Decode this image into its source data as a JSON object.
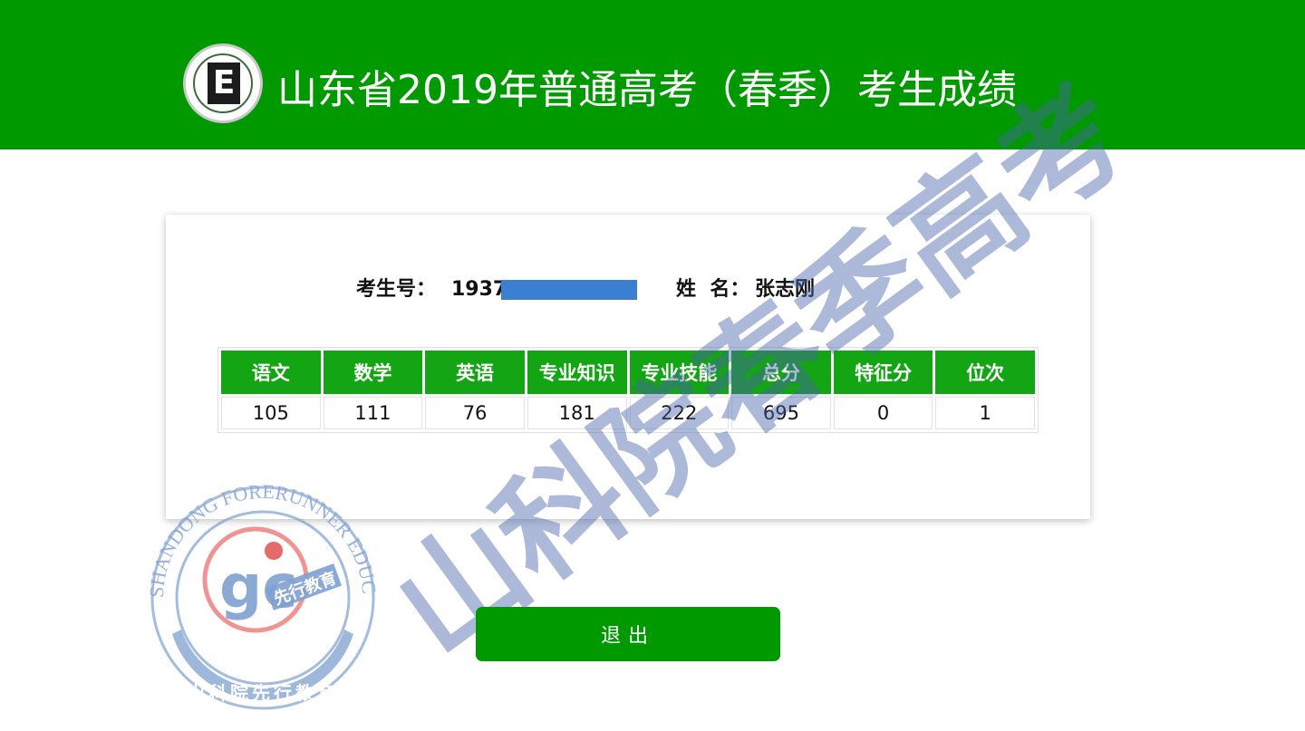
{
  "header": {
    "title": "山东省2019年普通高考（春季）考生成绩",
    "logo_letter": "E",
    "background_color": "#009a00"
  },
  "student": {
    "id_label": "考生号：",
    "id_value": "1937",
    "name_label": "姓  名：",
    "name_value": "张志刚"
  },
  "scores": {
    "columns": [
      "语文",
      "数学",
      "英语",
      "专业知识",
      "专业技能",
      "总分",
      "特征分",
      "位次"
    ],
    "values": [
      "105",
      "111",
      "76",
      "181",
      "222",
      "695",
      "0",
      "1"
    ]
  },
  "watermark": {
    "text": "山科院春季高考"
  },
  "seal": {
    "outer_text": "SHANDONG FORERUNNER EDUCATION",
    "inner_logo": "gc",
    "inner_label": "先行教育",
    "bottom_text": "山科院先行教育"
  },
  "exit_button": {
    "label": "退出"
  },
  "colors": {
    "accent": "#009a00",
    "table_header": "#14a514",
    "watermark": "#4664aa",
    "seal": "#7ea0d0",
    "redaction": "#3a7fd0"
  }
}
